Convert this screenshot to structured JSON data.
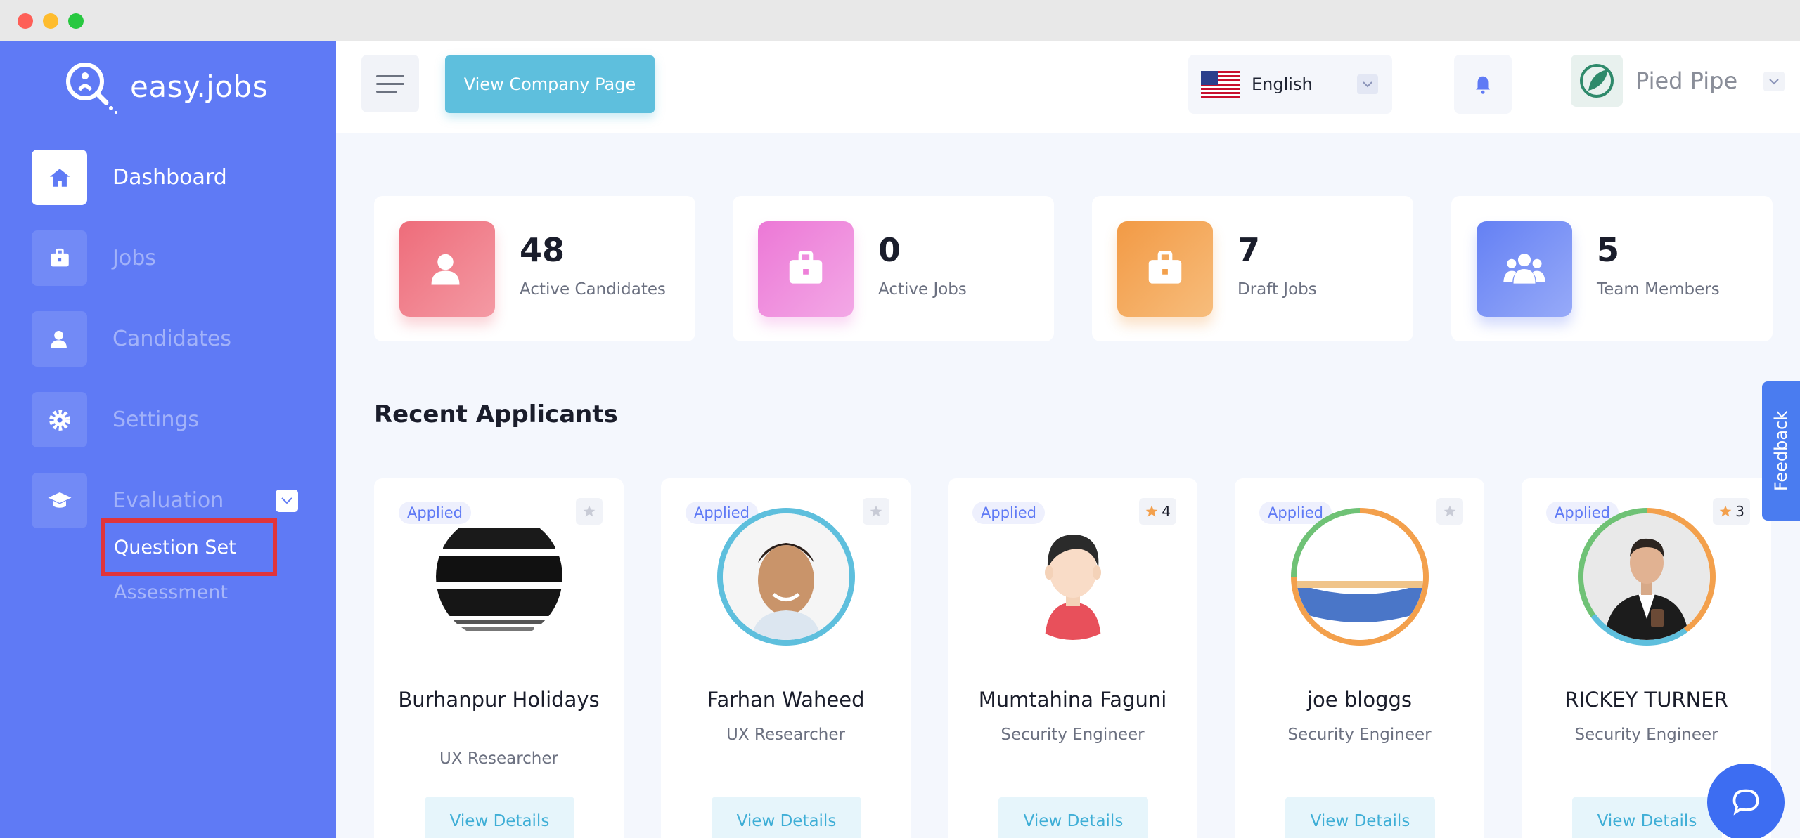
{
  "brand": {
    "name": "easy.jobs",
    "accent": "#5f7af5"
  },
  "sidebar": {
    "items": [
      {
        "label": "Dashboard",
        "icon": "home-icon",
        "active": true
      },
      {
        "label": "Jobs",
        "icon": "briefcase-icon",
        "active": false
      },
      {
        "label": "Candidates",
        "icon": "user-icon",
        "active": false
      },
      {
        "label": "Settings",
        "icon": "gear-icon",
        "active": false
      },
      {
        "label": "Evaluation",
        "icon": "graduation-cap-icon",
        "active": false
      }
    ],
    "evaluation_sub": [
      {
        "label": "Question Set",
        "active": true
      },
      {
        "label": "Assessment",
        "active": false
      }
    ]
  },
  "header": {
    "view_company_label": "View Company Page",
    "language": "English",
    "company_name": "Pied Pipe"
  },
  "stats": [
    {
      "value": "48",
      "label": "Active Candidates",
      "color": "#f0707e"
    },
    {
      "value": "0",
      "label": "Active Jobs",
      "color": "#ee80d9"
    },
    {
      "value": "7",
      "label": "Draft Jobs",
      "color": "#f3a04c"
    },
    {
      "value": "5",
      "label": "Team Members",
      "color": "#6f87f5"
    }
  ],
  "recent": {
    "title": "Recent Applicants",
    "applicants": [
      {
        "status": "Applied",
        "name": "Burhanpur Holidays",
        "role": "UX Researcher",
        "rating": "",
        "action": "View Details"
      },
      {
        "status": "Applied",
        "name": "Farhan Waheed",
        "role": "UX Researcher",
        "rating": "",
        "action": "View Details"
      },
      {
        "status": "Applied",
        "name": "Mumtahina Faguni",
        "role": "Security Engineer",
        "rating": "4",
        "action": "View Details"
      },
      {
        "status": "Applied",
        "name": "joe bloggs",
        "role": "Security Engineer",
        "rating": "",
        "action": "View Details"
      },
      {
        "status": "Applied",
        "name": "RICKEY TURNER",
        "role": "Security Engineer",
        "rating": "3",
        "action": "View Details"
      }
    ]
  },
  "feedback_label": "Feedback"
}
